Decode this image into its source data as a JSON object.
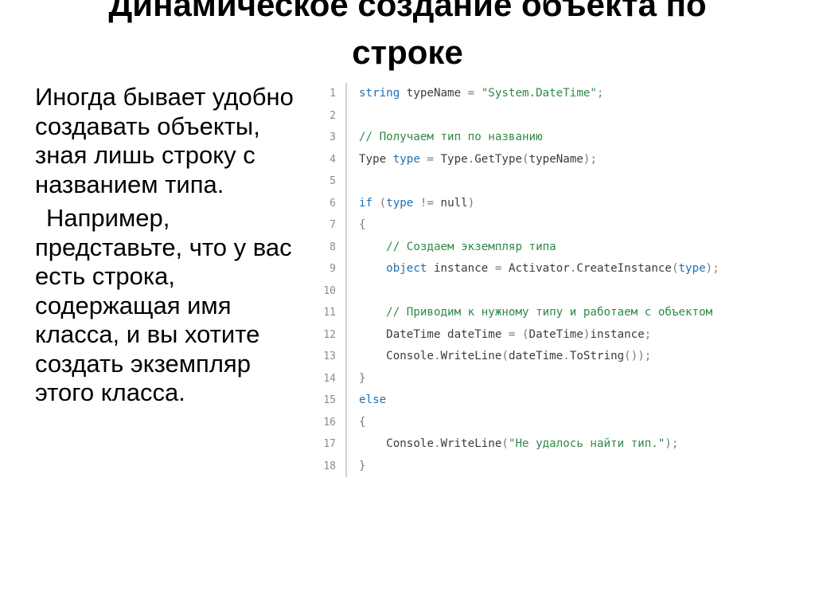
{
  "title": {
    "line1": "Динамическое создание объекта по",
    "line2": "строке"
  },
  "body": {
    "paragraph1": "Иногда бывает удобно создавать объекты, зная лишь строку с названием типа.",
    "paragraph2": "Например, представьте, что у вас есть строка, содержащая имя класса, и вы хотите создать экземпляр этого класса."
  },
  "code": {
    "language": "csharp",
    "lines": [
      {
        "n": "1",
        "tokens": [
          {
            "t": "string",
            "c": "kw"
          },
          {
            "t": " typeName ",
            "c": "pl"
          },
          {
            "t": "=",
            "c": "pn"
          },
          {
            "t": " \"System.DateTime\"",
            "c": "str"
          },
          {
            "t": ";",
            "c": "pn"
          }
        ]
      },
      {
        "n": "2",
        "tokens": []
      },
      {
        "n": "3",
        "tokens": [
          {
            "t": "// Получаем тип по названию",
            "c": "cm"
          }
        ]
      },
      {
        "n": "4",
        "tokens": [
          {
            "t": "Type",
            "c": "pl"
          },
          {
            "t": " type",
            "c": "kw"
          },
          {
            "t": " = ",
            "c": "pn"
          },
          {
            "t": "Type",
            "c": "pl"
          },
          {
            "t": ".",
            "c": "pn"
          },
          {
            "t": "GetType",
            "c": "pl"
          },
          {
            "t": "(",
            "c": "pn"
          },
          {
            "t": "typeName",
            "c": "pl"
          },
          {
            "t": ");",
            "c": "pn"
          }
        ]
      },
      {
        "n": "5",
        "tokens": []
      },
      {
        "n": "6",
        "tokens": [
          {
            "t": "if",
            "c": "kw"
          },
          {
            "t": " (",
            "c": "pn"
          },
          {
            "t": "type",
            "c": "kw"
          },
          {
            "t": " != ",
            "c": "pn"
          },
          {
            "t": "null",
            "c": "pl"
          },
          {
            "t": ")",
            "c": "pn"
          }
        ]
      },
      {
        "n": "7",
        "tokens": [
          {
            "t": "{",
            "c": "pn"
          }
        ]
      },
      {
        "n": "8",
        "tokens": [
          {
            "t": "    // Создаем экземпляр типа",
            "c": "cm"
          }
        ]
      },
      {
        "n": "9",
        "tokens": [
          {
            "t": "    object",
            "c": "kw"
          },
          {
            "t": " instance ",
            "c": "pl"
          },
          {
            "t": "= ",
            "c": "pn"
          },
          {
            "t": "Activator",
            "c": "pl"
          },
          {
            "t": ".",
            "c": "pn"
          },
          {
            "t": "CreateInstance",
            "c": "pl"
          },
          {
            "t": "(",
            "c": "pn"
          },
          {
            "t": "type",
            "c": "kw"
          },
          {
            "t": ");",
            "c": "pn"
          }
        ]
      },
      {
        "n": "10",
        "tokens": []
      },
      {
        "n": "11",
        "tokens": [
          {
            "t": "    // Приводим к нужному типу и работаем с объектом",
            "c": "cm"
          }
        ]
      },
      {
        "n": "12",
        "tokens": [
          {
            "t": "    DateTime",
            "c": "pl"
          },
          {
            "t": " dateTime ",
            "c": "pl"
          },
          {
            "t": "= (",
            "c": "pn"
          },
          {
            "t": "DateTime",
            "c": "pl"
          },
          {
            "t": ")",
            "c": "pn"
          },
          {
            "t": "instance",
            "c": "pl"
          },
          {
            "t": ";",
            "c": "pn"
          }
        ]
      },
      {
        "n": "13",
        "tokens": [
          {
            "t": "    Console",
            "c": "pl"
          },
          {
            "t": ".",
            "c": "pn"
          },
          {
            "t": "WriteLine",
            "c": "pl"
          },
          {
            "t": "(",
            "c": "pn"
          },
          {
            "t": "dateTime",
            "c": "pl"
          },
          {
            "t": ".",
            "c": "pn"
          },
          {
            "t": "ToString",
            "c": "pl"
          },
          {
            "t": "());",
            "c": "pn"
          }
        ]
      },
      {
        "n": "14",
        "tokens": [
          {
            "t": "}",
            "c": "pn"
          }
        ]
      },
      {
        "n": "15",
        "tokens": [
          {
            "t": "else",
            "c": "kw"
          }
        ]
      },
      {
        "n": "16",
        "tokens": [
          {
            "t": "{",
            "c": "pn"
          }
        ]
      },
      {
        "n": "17",
        "tokens": [
          {
            "t": "    Console",
            "c": "pl"
          },
          {
            "t": ".",
            "c": "pn"
          },
          {
            "t": "WriteLine",
            "c": "pl"
          },
          {
            "t": "(",
            "c": "pn"
          },
          {
            "t": "\"Не удалось найти тип.\"",
            "c": "str"
          },
          {
            "t": ");",
            "c": "pn"
          }
        ]
      },
      {
        "n": "18",
        "tokens": [
          {
            "t": "}",
            "c": "pn"
          }
        ]
      }
    ]
  }
}
